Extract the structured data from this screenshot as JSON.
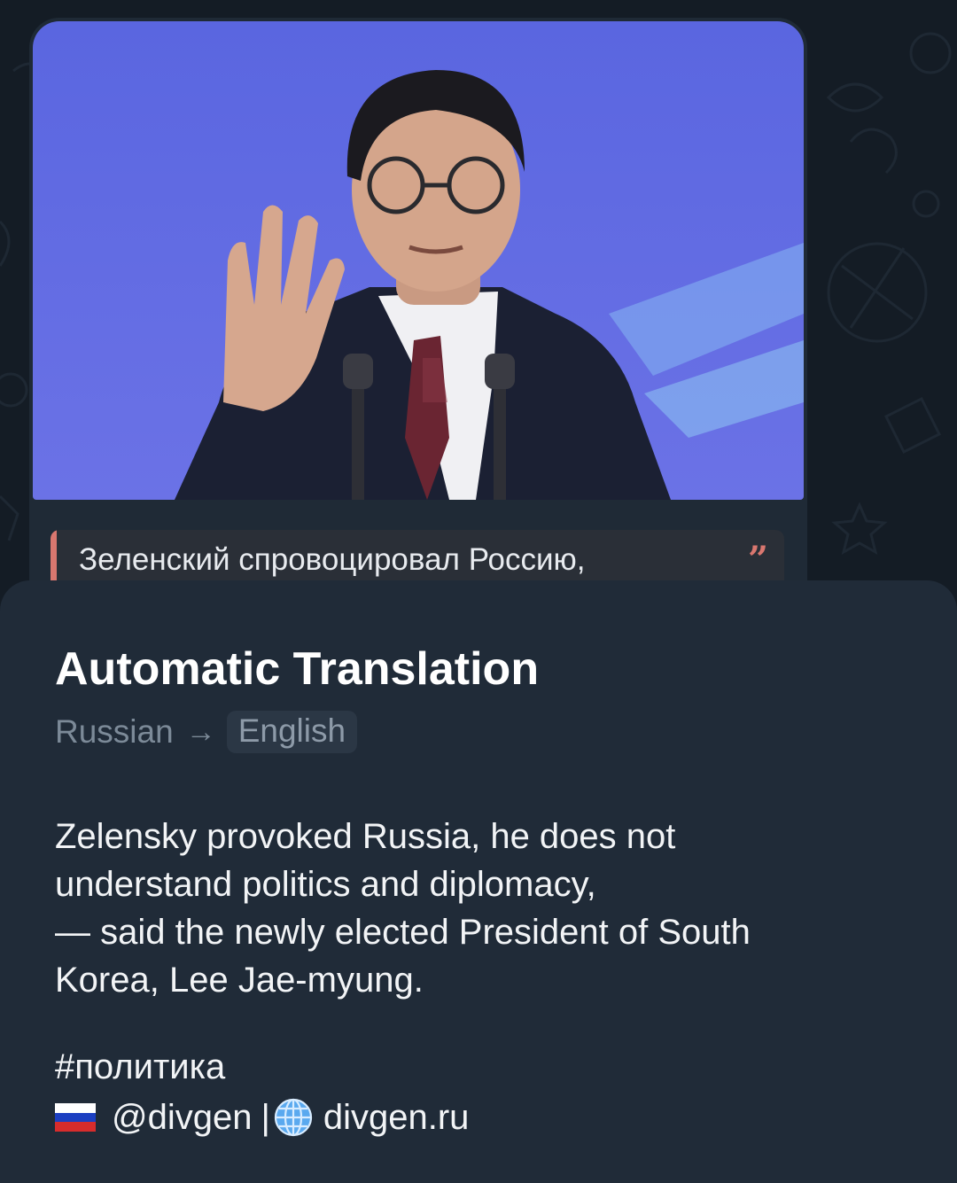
{
  "message": {
    "photo": {
      "icon": "photo"
    },
    "quote": {
      "text": "Зеленский спровоцировал Россию,",
      "icon": "quote-icon",
      "accent": "#d9776f"
    }
  },
  "translation_sheet": {
    "title": "Automatic Translation",
    "from_language": "Russian",
    "arrow": "→",
    "to_language": "English",
    "body_lines": [
      "Zelensky provoked Russia, he does not",
      "understand politics and diplomacy,",
      "— said the newly elected President of South",
      "Korea, Lee Jae-myung."
    ],
    "hashtag": "#политика",
    "footer": {
      "flag_icon": "russia-flag-icon",
      "handle": "@divgen",
      "separator": "|",
      "globe_icon": "globe-icon",
      "site": "divgen.ru"
    }
  },
  "colors": {
    "background": "#141c25",
    "bubble": "#1f2a36",
    "sheet": "#202b38",
    "quote_accent": "#d9776f",
    "secondary_text": "#7c8a98"
  }
}
